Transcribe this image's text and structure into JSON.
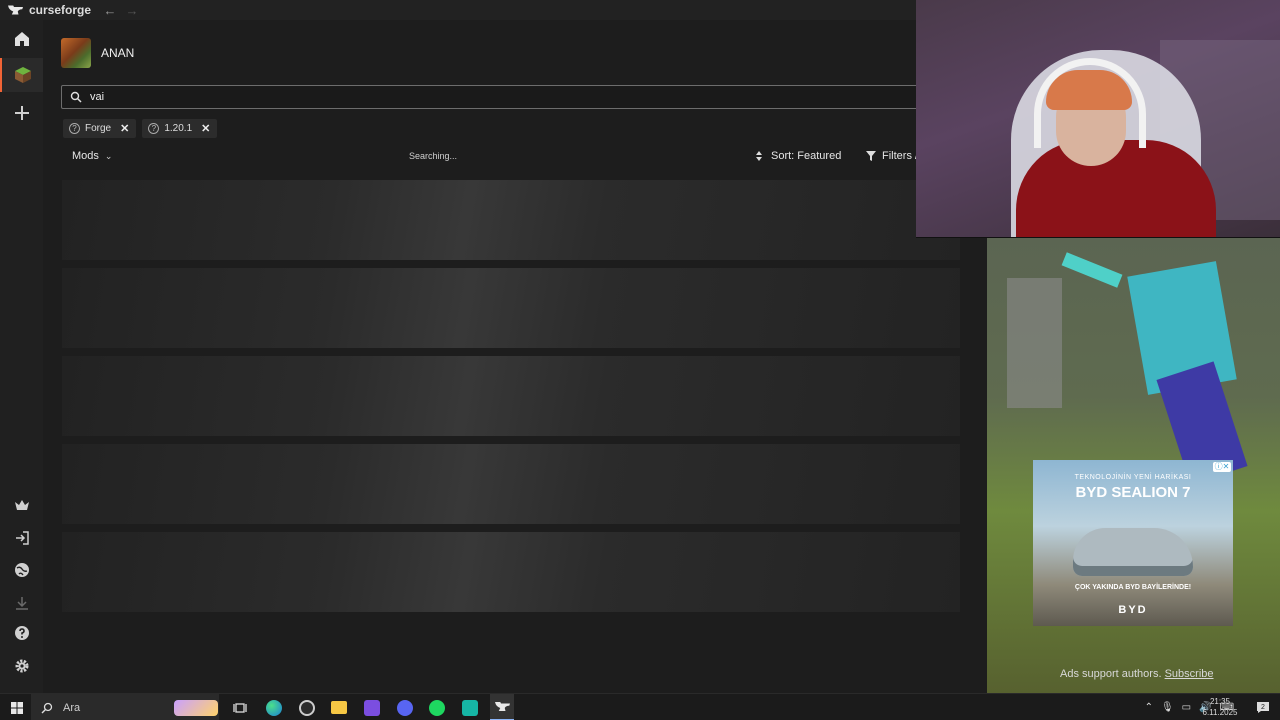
{
  "app": {
    "name": "curseforge"
  },
  "profile": {
    "name": "ANAN"
  },
  "search": {
    "value": "vai",
    "placeholder": ""
  },
  "filters": [
    {
      "label": "Forge"
    },
    {
      "label": "1.20.1"
    }
  ],
  "toolbar": {
    "category": "Mods",
    "status": "Searching...",
    "sort": "Sort: Featured",
    "filters": "Filters /"
  },
  "ad": {
    "top_line": "TEKNOLOJİNİN YENİ HARİKASI",
    "title": "BYD SEALION 7",
    "tagline": "ÇOK YAKINDA BYD BAYİLERİNDE!",
    "brand": "BYD",
    "support": "Ads support authors.",
    "subscribe": "Subscribe"
  },
  "taskbar": {
    "search_label": "Ara",
    "time": "21:35",
    "date": "6.11.2025"
  },
  "colors": {
    "accent": "#f16436",
    "background": "#1d1d1d",
    "sidebar": "#202020"
  }
}
